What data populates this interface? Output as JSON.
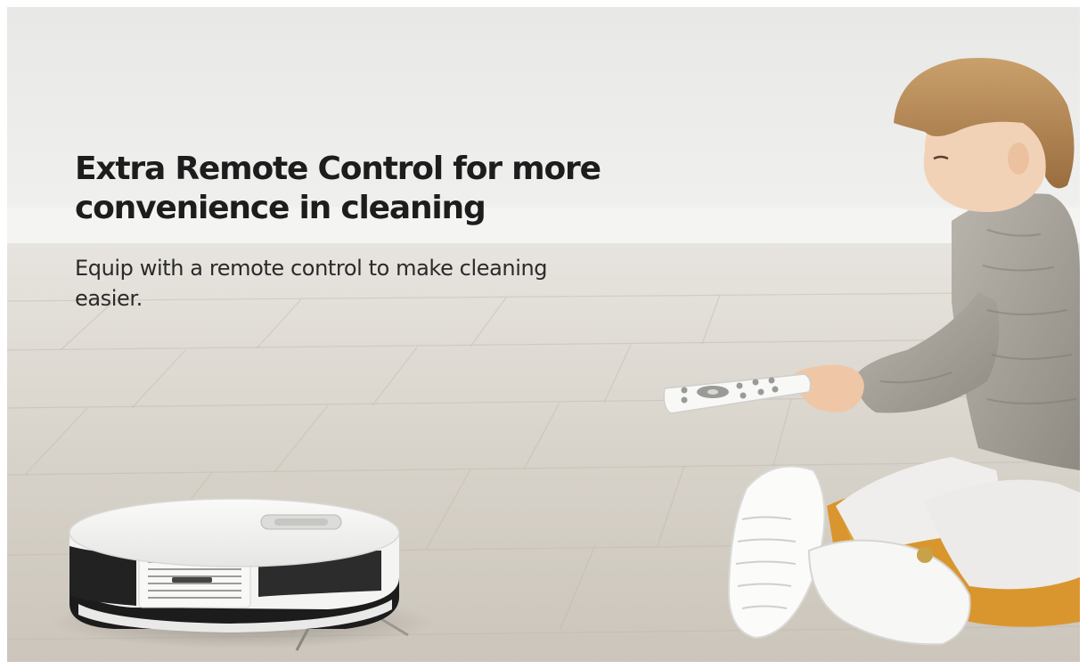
{
  "banner": {
    "headline": "Extra Remote Control for more convenience in cleaning",
    "description": "Equip with a remote control to make cleaning easier."
  },
  "colors": {
    "text_dark": "#1d1d1d",
    "robot_body": "#f4f4f2",
    "robot_bumper": "#1c1c1c",
    "cushion": "#d9962e",
    "sweater": "#a9a59c",
    "hair": "#b98a58"
  },
  "icons": {
    "robot": "robot-vacuum",
    "remote": "remote-control",
    "child": "child-figure"
  }
}
